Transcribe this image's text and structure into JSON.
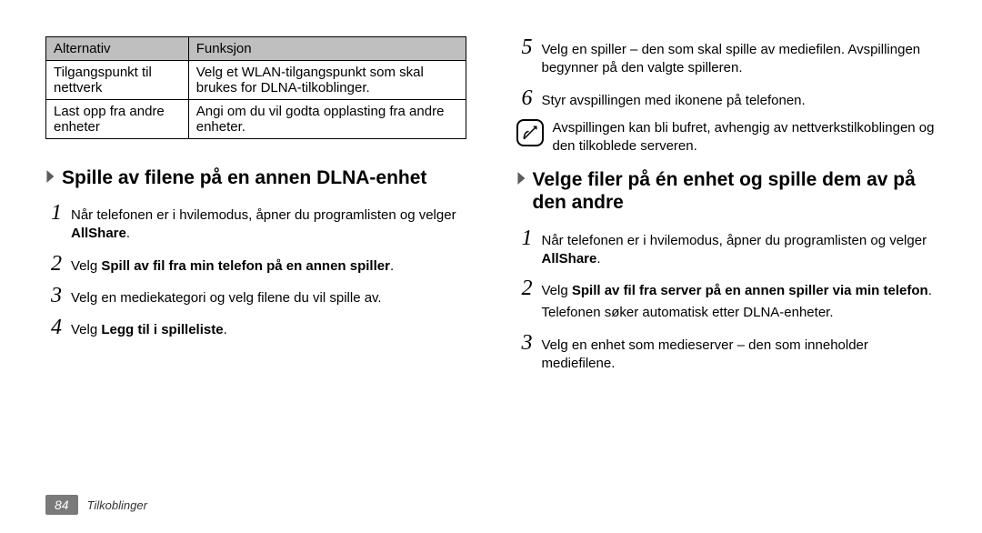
{
  "table": {
    "headers": {
      "option": "Alternativ",
      "function": "Funksjon"
    },
    "rows": [
      {
        "option": "Tilgangspunkt til nettverk",
        "function": "Velg et WLAN-tilgangspunkt som skal brukes for DLNA-tilkoblinger."
      },
      {
        "option": "Last opp fra andre enheter",
        "function": "Angi om du vil godta opplasting fra andre enheter."
      }
    ]
  },
  "section1": {
    "title": "Spille av filene på en annen DLNA-enhet",
    "steps": {
      "s1a": "Når telefonen er i hvilemodus, åpner du programlisten og velger ",
      "s1b": "AllShare",
      "s1c": ".",
      "s2a": "Velg ",
      "s2b": "Spill av fil fra min telefon på en annen spiller",
      "s2c": ".",
      "s3": "Velg en mediekategori og velg filene du vil spille av.",
      "s4a": "Velg ",
      "s4b": "Legg til i spilleliste",
      "s4c": "."
    }
  },
  "right_steps": {
    "s5": "Velg en spiller – den som skal spille av mediefilen. Avspillingen begynner på den valgte spilleren.",
    "s6": "Styr avspillingen med ikonene på telefonen."
  },
  "note": "Avspillingen kan bli bufret, avhengig av nettverkstilkoblingen og den tilkoblede serveren.",
  "section2": {
    "title": "Velge filer på én enhet og spille dem av på den andre",
    "steps": {
      "s1a": "Når telefonen er i hvilemodus, åpner du programlisten og velger ",
      "s1b": "AllShare",
      "s1c": ".",
      "s2a": "Velg ",
      "s2b": "Spill av fil fra server på en annen spiller via min telefon",
      "s2c": ".",
      "sub": "Telefonen søker automatisk etter DLNA-enheter.",
      "s3": "Velg en enhet som medieserver – den som inneholder mediefilene."
    }
  },
  "footer": {
    "page": "84",
    "section": "Tilkoblinger"
  }
}
